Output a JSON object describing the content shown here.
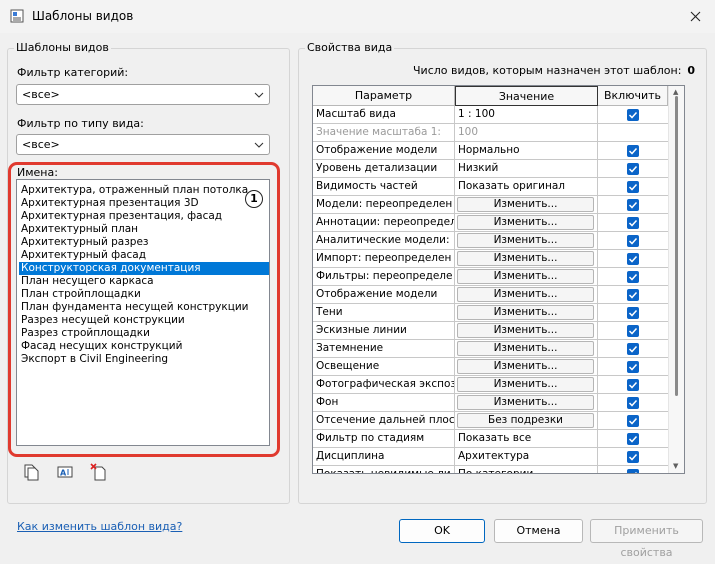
{
  "window": {
    "title": "Шаблоны видов"
  },
  "left_group": {
    "title": "Шаблоны видов",
    "category_filter_label": "Фильтр категорий:",
    "category_filter_value": "<все>",
    "view_type_filter_label": "Фильтр по типу вида:",
    "view_type_filter_value": "<все>",
    "names_label": "Имена:",
    "names": [
      "Архитектура, отраженный план потолка",
      "Архитектурная презентация 3D",
      "Архитектурная презентация, фасад",
      "Архитектурный план",
      "Архитектурный разрез",
      "Архитектурный фасад",
      "Конструкторская документация",
      "План несущего каркаса",
      "План стройплощадки",
      "План фундамента несущей конструкции",
      "Разрез несущей конструкции",
      "Разрез стройплощадки",
      "Фасад несущих конструкций",
      "Экспорт в Civil Engineering"
    ],
    "selected_index": 6,
    "callout_number": "1"
  },
  "help_link": "Как изменить шаблон вида?",
  "right_group": {
    "title": "Свойства вида",
    "count_label": "Число видов, которым назначен этот шаблон:",
    "count_value": "0",
    "columns": [
      "Параметр",
      "Значение",
      "Включить"
    ],
    "rows": [
      {
        "param": "Масштаб вида",
        "value": "1 : 100",
        "button": false,
        "checked": true,
        "disabled": false
      },
      {
        "param": "Значение масштаба    1:",
        "value": "100",
        "button": false,
        "checked": null,
        "disabled": true
      },
      {
        "param": "Отображение модели",
        "value": "Нормально",
        "button": false,
        "checked": true,
        "disabled": false
      },
      {
        "param": "Уровень детализации",
        "value": "Низкий",
        "button": false,
        "checked": true,
        "disabled": false
      },
      {
        "param": "Видимость частей",
        "value": "Показать оригинал",
        "button": false,
        "checked": true,
        "disabled": false
      },
      {
        "param": "Модели: переопределен",
        "value": "Изменить...",
        "button": true,
        "checked": true,
        "disabled": false
      },
      {
        "param": "Аннотации: переопредел",
        "value": "Изменить...",
        "button": true,
        "checked": true,
        "disabled": false
      },
      {
        "param": "Аналитические модели:",
        "value": "Изменить...",
        "button": true,
        "checked": true,
        "disabled": false
      },
      {
        "param": "Импорт: переопределен",
        "value": "Изменить...",
        "button": true,
        "checked": true,
        "disabled": false
      },
      {
        "param": "Фильтры: переопределе",
        "value": "Изменить...",
        "button": true,
        "checked": true,
        "disabled": false
      },
      {
        "param": "Отображение модели",
        "value": "Изменить...",
        "button": true,
        "checked": true,
        "disabled": false
      },
      {
        "param": "Тени",
        "value": "Изменить...",
        "button": true,
        "checked": true,
        "disabled": false
      },
      {
        "param": "Эскизные линии",
        "value": "Изменить...",
        "button": true,
        "checked": true,
        "disabled": false
      },
      {
        "param": "Затемнение",
        "value": "Изменить...",
        "button": true,
        "checked": true,
        "disabled": false
      },
      {
        "param": "Освещение",
        "value": "Изменить...",
        "button": true,
        "checked": true,
        "disabled": false
      },
      {
        "param": "Фотографическая экспоз",
        "value": "Изменить...",
        "button": true,
        "checked": true,
        "disabled": false
      },
      {
        "param": "Фон",
        "value": "Изменить...",
        "button": true,
        "checked": true,
        "disabled": false
      },
      {
        "param": "Отсечение дальней плос",
        "value": "Без подрезки",
        "button": true,
        "checked": true,
        "disabled": false
      },
      {
        "param": "Фильтр по стадиям",
        "value": "Показать все",
        "button": false,
        "checked": true,
        "disabled": false
      },
      {
        "param": "Дисциплина",
        "value": "Архитектура",
        "button": false,
        "checked": true,
        "disabled": false
      },
      {
        "param": "Показать невидимые ли",
        "value": "По категории",
        "button": false,
        "checked": true,
        "disabled": false
      }
    ]
  },
  "buttons": {
    "ok": "OK",
    "cancel": "Отмена",
    "apply": "Применить свойства"
  },
  "colors": {
    "selection": "#0078d7",
    "callout_border": "#e03a2f",
    "checkbox": "#0a64c8",
    "link": "#1a5fb4"
  },
  "icons": [
    "app-icon",
    "close-icon",
    "chevron-down-icon",
    "duplicate-icon",
    "rename-icon",
    "delete-icon",
    "checkmark-icon"
  ]
}
